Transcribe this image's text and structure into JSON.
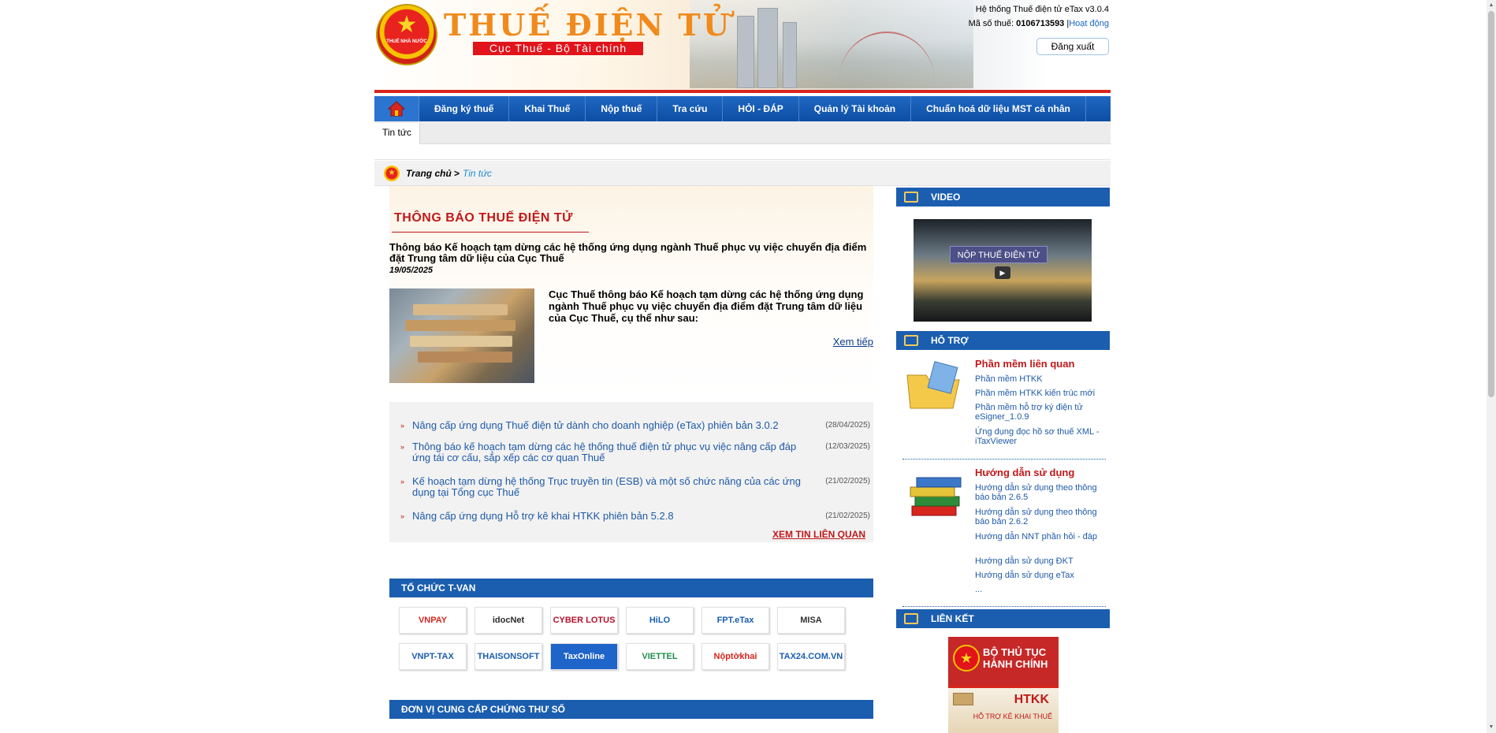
{
  "header": {
    "brand": "THUẾ ĐIỆN TỬ",
    "subbrand": "Cục Thuế - Bộ Tài chính",
    "emblem_text": "THUẾ NHÀ NƯỚC",
    "system_version": "Hệ thống Thuế điện tử eTax v3.0.4",
    "tax_id_label": "Mã số thuế:",
    "tax_id": "0106713593",
    "active_label": "Hoạt động",
    "logout": "Đăng xuất"
  },
  "nav": {
    "items": [
      "Đăng ký thuế",
      "Khai Thuế",
      "Nộp thuế",
      "Tra cứu",
      "HỎI - ĐÁP",
      "Quản lý Tài khoản",
      "Chuẩn hoá dữ liệu MST cá nhân"
    ],
    "subtab": "Tin tức"
  },
  "breadcrumb": {
    "home": "Trang chủ",
    "sep": ">",
    "current": "Tin tức"
  },
  "notice": {
    "section_title": "THÔNG BÁO THUẾ ĐIỆN TỬ",
    "headline": "Thông báo Kế hoạch tạm dừng các hệ thống ứng dụng ngành Thuế phục vụ việc chuyển địa điểm đặt Trung tâm dữ liệu của Cục Thuế",
    "date": "19/05/2025",
    "summary": "Cục Thuế thông báo Kế hoạch tạm dừng các hệ thống ứng dụng ngành Thuế phục vụ việc chuyển địa điểm đặt Trung tâm dữ liệu của Cục Thuế, cụ thể như sau:",
    "more": "Xem tiếp"
  },
  "news": [
    {
      "title": "Nâng cấp ứng dụng Thuế điện tử dành cho doanh nghiệp (eTax) phiên bản 3.0.2",
      "date": "(28/04/2025)"
    },
    {
      "title": "Thông báo kế hoạch tạm dừng các hệ thống thuế điện tử phục vụ việc nâng cấp đáp ứng tái cơ cấu, sắp xếp các cơ quan Thuế",
      "date": "(12/03/2025)"
    },
    {
      "title": "Kế hoạch tạm dừng hệ thống Trục truyền tin (ESB) và một số chức năng của các ứng dụng tại Tổng cục Thuế",
      "date": "(21/02/2025)"
    },
    {
      "title": "Nâng cấp ứng dụng Hỗ trợ kê khai HTKK phiên bản 5.2.8",
      "date": "(21/02/2025)"
    }
  ],
  "related": "XEM TIN LIÊN QUAN",
  "tvan": {
    "title": "TỔ CHỨC T-VAN",
    "logos": [
      {
        "name": "VNPAY",
        "color": "#d7261e"
      },
      {
        "name": "idocNet",
        "color": "#2b2b2b"
      },
      {
        "name": "CYBER LOTUS",
        "color": "#b3122c"
      },
      {
        "name": "HiLO",
        "color": "#1b5eaf"
      },
      {
        "name": "FPT.eTax",
        "color": "#1b5eaf"
      },
      {
        "name": "MISA",
        "color": "#333333"
      },
      {
        "name": "VNPT-TAX",
        "color": "#1b5eaf"
      },
      {
        "name": "THAISONSOFT",
        "color": "#1b5eaf"
      },
      {
        "name": "TaxOnline",
        "color": "#ffffff"
      },
      {
        "name": "VIETTEL",
        "color": "#1e8c4a"
      },
      {
        "name": "Nộptờkhai",
        "color": "#d7261e"
      },
      {
        "name": "TAX24.COM.VN",
        "color": "#1b5eaf"
      }
    ]
  },
  "cert": {
    "title": "ĐƠN VỊ CUNG CẤP CHỨNG THƯ SỐ"
  },
  "sidebar": {
    "video_title": "VIDEO",
    "video_caption": "NỘP THUẾ ĐIỆN TỬ",
    "support_title": "HỖ TRỢ",
    "software_title": "Phần mềm liên quan",
    "software_links": [
      "Phần mềm HTKK",
      "Phần mềm HTKK kiến trúc mới",
      "Phần mềm hỗ trợ ký điện tử eSigner_1.0.9",
      "Ứng dụng đọc hồ sơ thuế XML - iTaxViewer"
    ],
    "guide_title": "Hướng dẫn sử dụng",
    "guide_links": [
      "Hướng dẫn sử dụng theo thông báo bản 2.6.5",
      "Hướng dẫn sử dụng theo thông báo bản 2.6.2",
      "Hướng dẫn NNT phần hỏi - đáp",
      "Hướng dẫn sử dụng ĐKT",
      "Hướng dẫn sử dụng eTax",
      "..."
    ],
    "links_title": "LIÊN KẾT",
    "admin_line": "BỘ THỦ TỤC HÀNH CHÍNH",
    "htkk": "HTKK",
    "htkk_sub": "HỖ TRỢ KÊ KHAI THUẾ"
  }
}
